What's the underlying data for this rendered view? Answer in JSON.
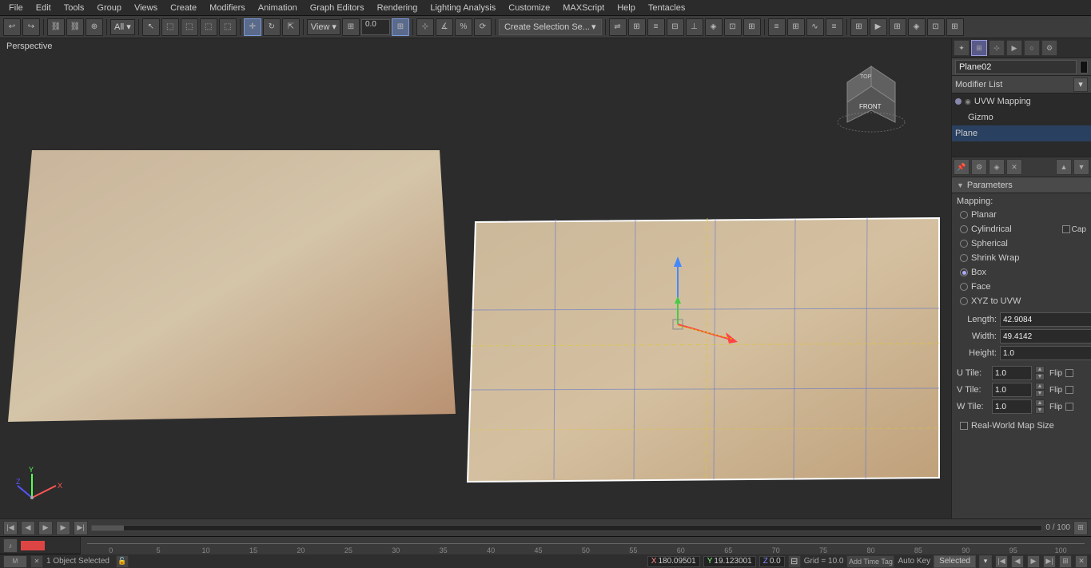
{
  "menubar": {
    "items": [
      "File",
      "Edit",
      "Tools",
      "Group",
      "Views",
      "Create",
      "Modifiers",
      "Animation",
      "Graph Editors",
      "Rendering",
      "Lighting Analysis",
      "Customize",
      "MAXScript",
      "Help",
      "Tentacles"
    ]
  },
  "toolbar": {
    "mode_dropdown": "All",
    "view_dropdown": "View",
    "coord_value": "0.0",
    "create_selection": "Create Selection Se..."
  },
  "viewport": {
    "label": "Perspective"
  },
  "viewcube": {
    "label": "FRONT",
    "top_label": "TOP"
  },
  "right_panel": {
    "object_name": "Plane02",
    "modifier_list_label": "Modifier List",
    "stack": [
      {
        "label": "UVW Mapping",
        "indent": false,
        "selected": false
      },
      {
        "label": "Gizmo",
        "indent": true,
        "selected": false
      },
      {
        "label": "Plane",
        "indent": false,
        "selected": true
      }
    ],
    "parameters": {
      "title": "Parameters",
      "mapping_label": "Mapping:",
      "options": [
        {
          "label": "Planar",
          "active": false
        },
        {
          "label": "Cylindrical",
          "active": false
        },
        {
          "label": "Spherical",
          "active": false
        },
        {
          "label": "Shrink Wrap",
          "active": false
        },
        {
          "label": "Box",
          "active": true
        },
        {
          "label": "Face",
          "active": false
        },
        {
          "label": "XYZ to UVW",
          "active": false
        }
      ],
      "cap_label": "Cap",
      "length_label": "Length:",
      "length_value": "42.9084",
      "width_label": "Width:",
      "width_value": "49.4142",
      "height_label": "Height:",
      "height_value": "1.0",
      "u_tile_label": "U Tile:",
      "u_tile_value": "1.0",
      "v_tile_label": "V Tile:",
      "v_tile_value": "1.0",
      "w_tile_label": "W Tile:",
      "w_tile_value": "1.0",
      "flip_label": "Flip",
      "realworld_label": "Real-World Map Size"
    }
  },
  "bottom_bar": {
    "frame_label": "0 / 100"
  },
  "timeline": {
    "ticks": [
      "0",
      "5",
      "10",
      "15",
      "20",
      "25",
      "30",
      "35",
      "40",
      "45",
      "50",
      "55",
      "60",
      "65",
      "70",
      "75",
      "80",
      "85",
      "90",
      "95",
      "100"
    ]
  },
  "status_bar": {
    "object_status": "1 Object Selected",
    "x_label": "X",
    "x_value": "180.09501",
    "y_label": "Y",
    "y_value": "19.123001",
    "z_label": "Z",
    "z_value": "0.0",
    "grid_label": "Grid = 10.0",
    "autokey_label": "Auto Key",
    "selected_label": "Selected"
  }
}
